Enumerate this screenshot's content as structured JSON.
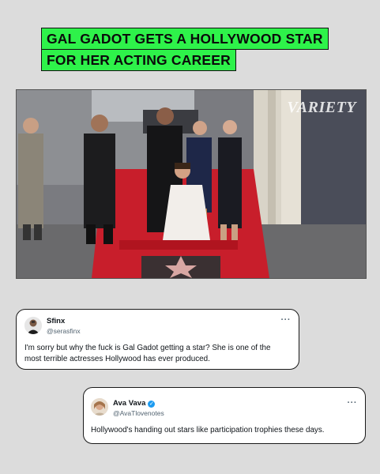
{
  "headline": {
    "line1": "GAL GADOT GETS A HOLLYWOOD STAR",
    "line2": "FOR HER ACTING CAREER",
    "highlight_color": "#2ef24a"
  },
  "photo": {
    "watermark": "VARIETY",
    "description_icon": "event-photo"
  },
  "tweets": [
    {
      "name": "Sfinx",
      "handle": "@serasfinx",
      "verified": false,
      "text": "I'm sorry but why the fuck is Gal Gadot getting a star? She is one of the most terrible actresses Hollywood has ever produced.",
      "more_icon": "more-dots-icon"
    },
    {
      "name": "Ava Vava",
      "handle": "@AvaTlovenotes",
      "verified": true,
      "text": "Hollywood's handing out stars like participation trophies these days.",
      "more_icon": "more-dots-icon"
    }
  ],
  "colors": {
    "background": "#dcdcdc",
    "verified_badge": "#1d9bf0"
  }
}
